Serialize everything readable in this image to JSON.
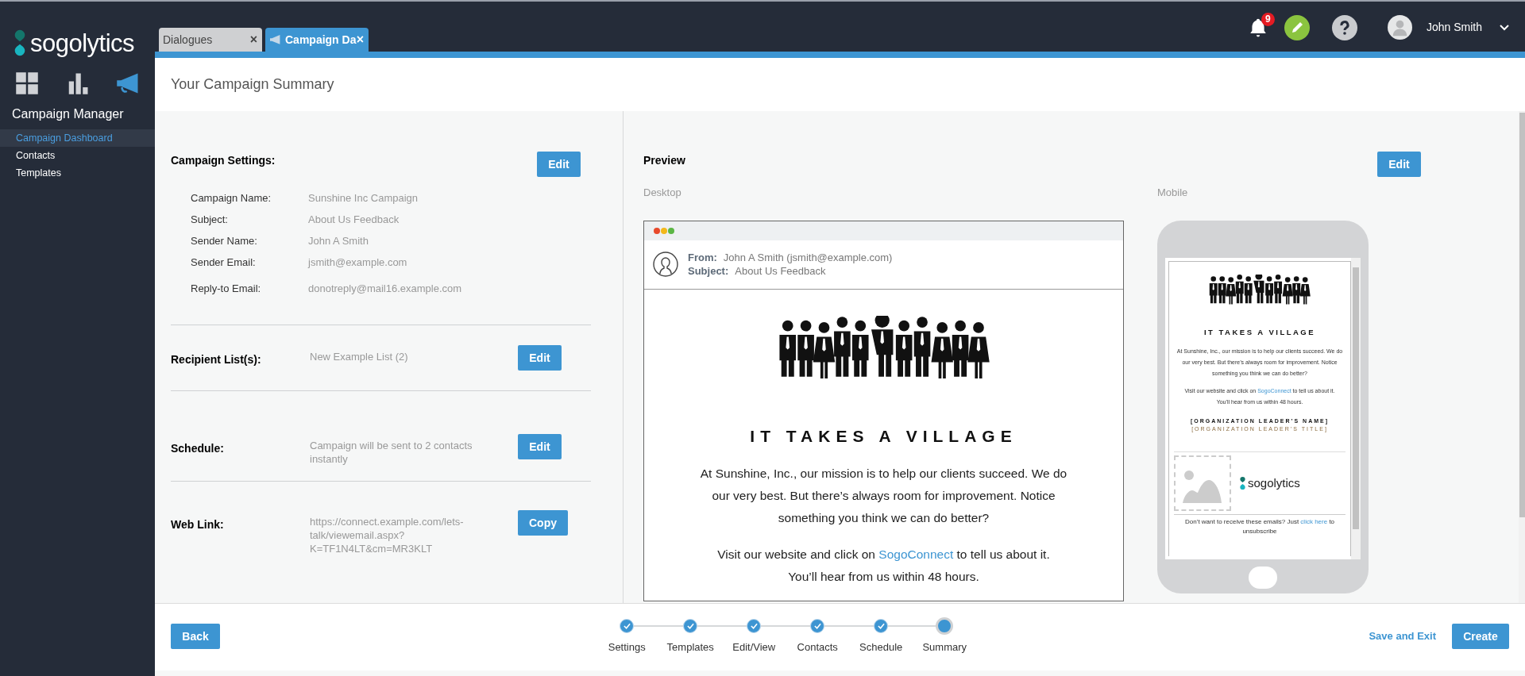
{
  "app": {
    "logo_text": "sogolytics",
    "nav_icons": [
      {
        "kind": "grid",
        "selected": false
      },
      {
        "kind": "chart",
        "selected": false
      },
      {
        "kind": "megaphone",
        "selected": true
      }
    ],
    "section_title": "Campaign Manager",
    "nav_items": [
      {
        "label": "Campaign Dashboard",
        "selected": true
      },
      {
        "label": "Contacts",
        "selected": false
      },
      {
        "label": "Templates",
        "selected": false
      }
    ]
  },
  "tabs": [
    {
      "label": "Dialogues",
      "selected": false,
      "close": "×"
    },
    {
      "label": "Campaign Da",
      "selected": true,
      "close": "×"
    }
  ],
  "header": {
    "notification_count": "9",
    "user_name": "John Smith"
  },
  "page_title": "Your Campaign Summary",
  "campaign_settings": {
    "title": "Campaign Settings:",
    "button": "Edit",
    "fields": [
      {
        "label": "Campaign Name:",
        "value": "Sunshine Inc Campaign"
      },
      {
        "label": "Subject:",
        "value": "About Us Feedback"
      },
      {
        "label": "Sender Name:",
        "value": "John A Smith"
      },
      {
        "label": "Sender Email:",
        "value": "jsmith@example.com"
      },
      {
        "label": "Reply-to Email:",
        "value": "donotreply@mail16.example.com"
      }
    ]
  },
  "sections": [
    {
      "title": "Recipient List(s):",
      "value": "New Example List (2)",
      "button": "Edit"
    },
    {
      "title": "Schedule:",
      "value": "Campaign will be sent to 2 contacts instantly",
      "button": "Edit"
    },
    {
      "title": "Web Link:",
      "value": "https://connect.example.com/lets-talk/viewemail.aspx?K=TF1N4LT&cm=MR3KLT",
      "button": "Copy"
    }
  ],
  "preview": {
    "title": "Preview",
    "button": "Edit",
    "desktop": {
      "label": "Desktop",
      "from_label": "From:",
      "from": "John A Smith (jsmith@example.com)",
      "subject_label": "Subject:",
      "subject": "About Us Feedback",
      "heading": "IT TAKES A VILLAGE",
      "body": "At Sunshine, Inc., our mission is to help our clients succeed. We do our very best. But there’s always room for improvement. Notice something you think we can do better?",
      "visit_before": "Visit our website and click on",
      "visit_link": "SogoConnect",
      "visit_after": "to tell us about it.",
      "closing": "You’ll hear from us within 48 hours."
    },
    "mobile": {
      "label": "Mobile",
      "heading": "IT TAKES A VILLAGE",
      "body": "At Sunshine, Inc., our mission is to help our clients succeed. We do our very best. But there’s always room for improvement. Notice something you think we can do better?",
      "visit_before": "Visit our website and click on",
      "visit_link": "SogoConnect",
      "visit_after": "to tell us about it.",
      "closing": "You’ll hear from us within 48 hours.",
      "leader_name": "[ORGANIZATION LEADER’S NAME]",
      "leader_title": "[ORGANIZATION LEADER’S TITLE]",
      "logo_text": "sogolytics",
      "footer_before": "Don’t want to receive these emails? Just",
      "footer_link": "click here",
      "footer_after": "to unsubscribe"
    }
  },
  "footer": {
    "back": "Back",
    "steps": [
      {
        "label": "Settings",
        "done": true,
        "selected": false
      },
      {
        "label": "Templates",
        "done": true,
        "selected": false
      },
      {
        "label": "Edit/View",
        "done": true,
        "selected": false
      },
      {
        "label": "Contacts",
        "done": true,
        "selected": false
      },
      {
        "label": "Schedule",
        "done": true,
        "selected": false
      },
      {
        "label": "Summary",
        "done": false,
        "selected": true
      }
    ],
    "save": "Save and Exit",
    "create": "Create"
  }
}
